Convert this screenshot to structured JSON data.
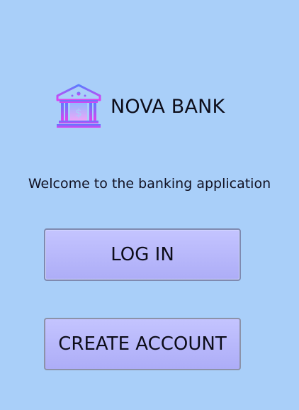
{
  "app": {
    "name": "NOVA BANK",
    "logo_icon": "bank-icon"
  },
  "welcome_text": "Welcome to the banking application",
  "buttons": {
    "login_label": "LOG IN",
    "create_account_label": "CREATE ACCOUNT"
  },
  "colors": {
    "background": "#a9cff9",
    "button_fill": "#b9b9fc",
    "logo_gradient_top": "#5a7cff",
    "logo_gradient_bottom": "#e040f0"
  }
}
